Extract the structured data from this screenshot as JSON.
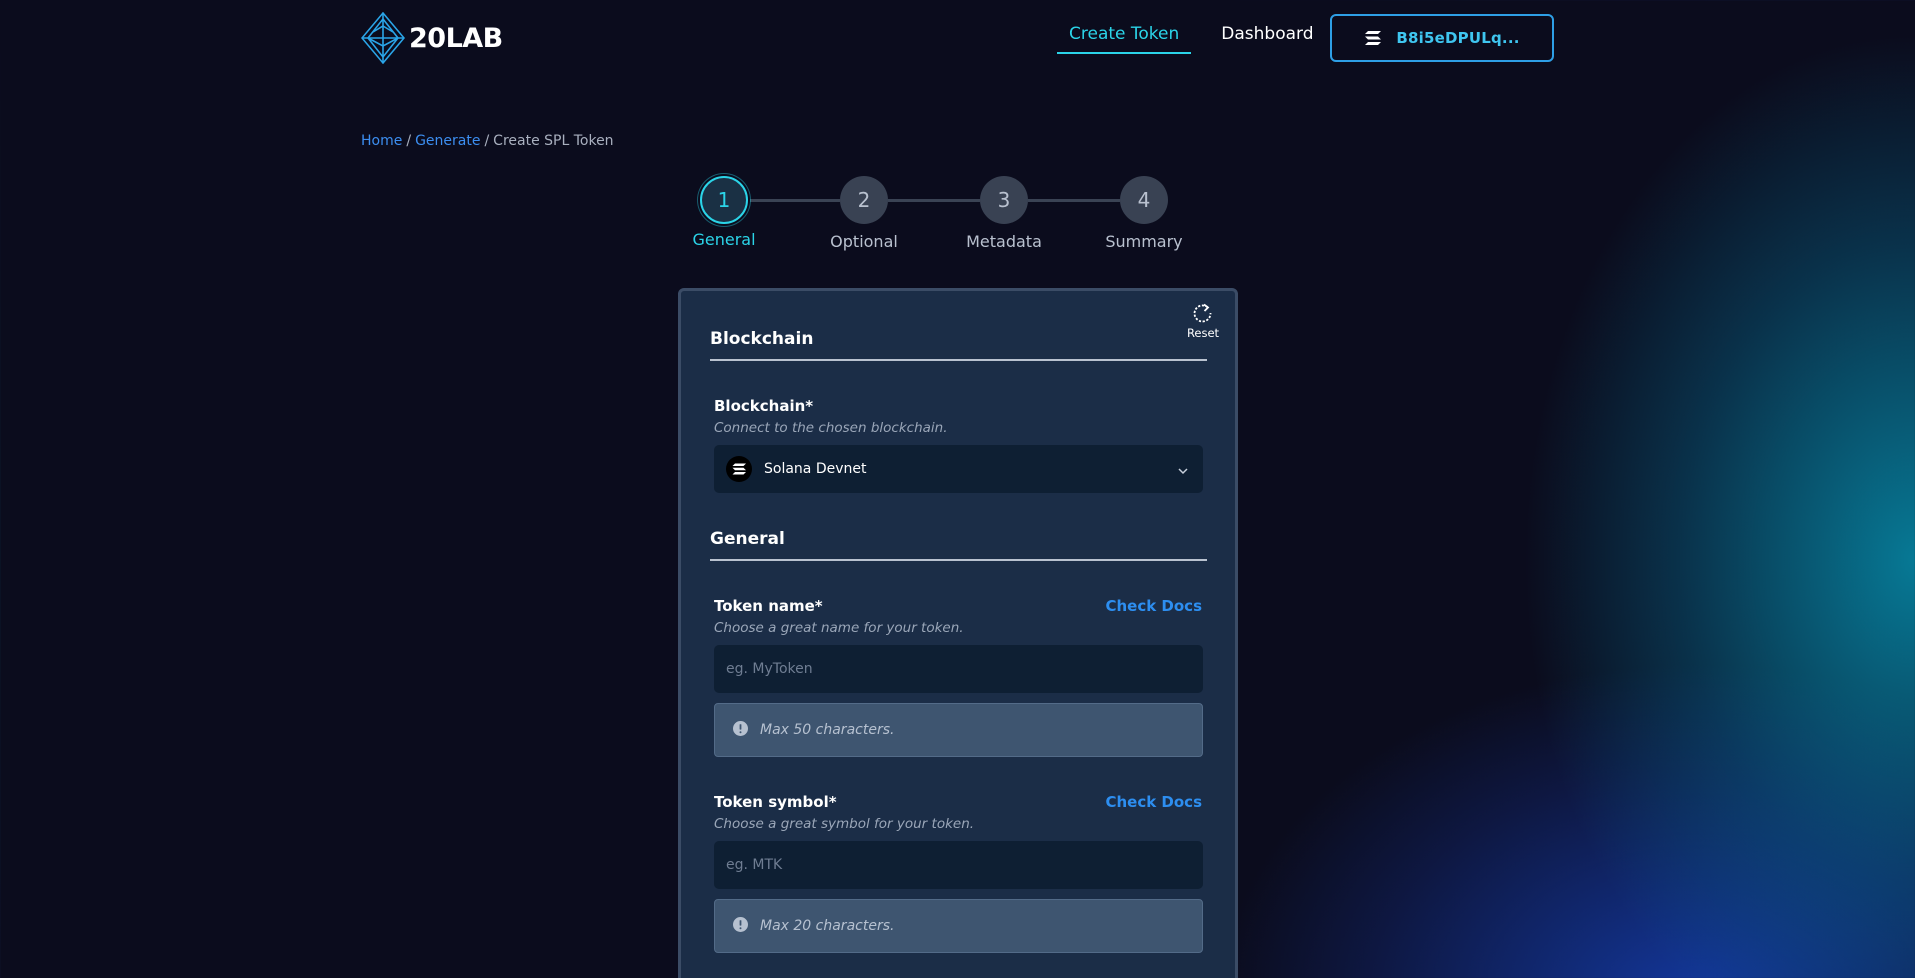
{
  "header": {
    "logo_text": "20LAB",
    "nav": [
      {
        "label": "Create Token",
        "active": true
      },
      {
        "label": "Dashboard",
        "active": false
      }
    ],
    "wallet": {
      "address": "B8i5eDPULq..."
    }
  },
  "breadcrumb": {
    "items": [
      "Home",
      "Generate",
      "Create SPL Token"
    ],
    "separator": "/"
  },
  "stepper": {
    "steps": [
      {
        "number": "1",
        "label": "General"
      },
      {
        "number": "2",
        "label": "Optional"
      },
      {
        "number": "3",
        "label": "Metadata"
      },
      {
        "number": "4",
        "label": "Summary"
      }
    ],
    "active_step": 1
  },
  "card": {
    "reset_label": "Reset",
    "blockchain_section": {
      "title": "Blockchain",
      "field_label": "Blockchain*",
      "hint": "Connect to the chosen blockchain.",
      "selected": "Solana Devnet"
    },
    "general_section": {
      "title": "General",
      "token_name": {
        "label": "Token name*",
        "docs_link": "Check Docs",
        "hint": "Choose a great name for your token.",
        "value": "",
        "placeholder": "eg. MyToken",
        "note": "Max 50 characters."
      },
      "token_symbol": {
        "label": "Token symbol*",
        "docs_link": "Check Docs",
        "hint": "Choose a great symbol for your token.",
        "value": "",
        "placeholder": "eg. MTK",
        "note": "Max 20 characters."
      }
    }
  },
  "icons": {
    "logo": "diamond-logo-icon",
    "wallet": "solana-icon",
    "reset": "refresh-icon",
    "select_chain": "solana-icon",
    "select_arrow": "chevron-down-icon",
    "note": "info-icon"
  },
  "colors": {
    "background": "#0b0c1d",
    "accent_cyan": "#2bd4e8",
    "link_blue": "#2d8ef0",
    "card_bg": "#1b2d47",
    "input_bg": "#0e1f33",
    "note_bg": "#3e5570"
  }
}
